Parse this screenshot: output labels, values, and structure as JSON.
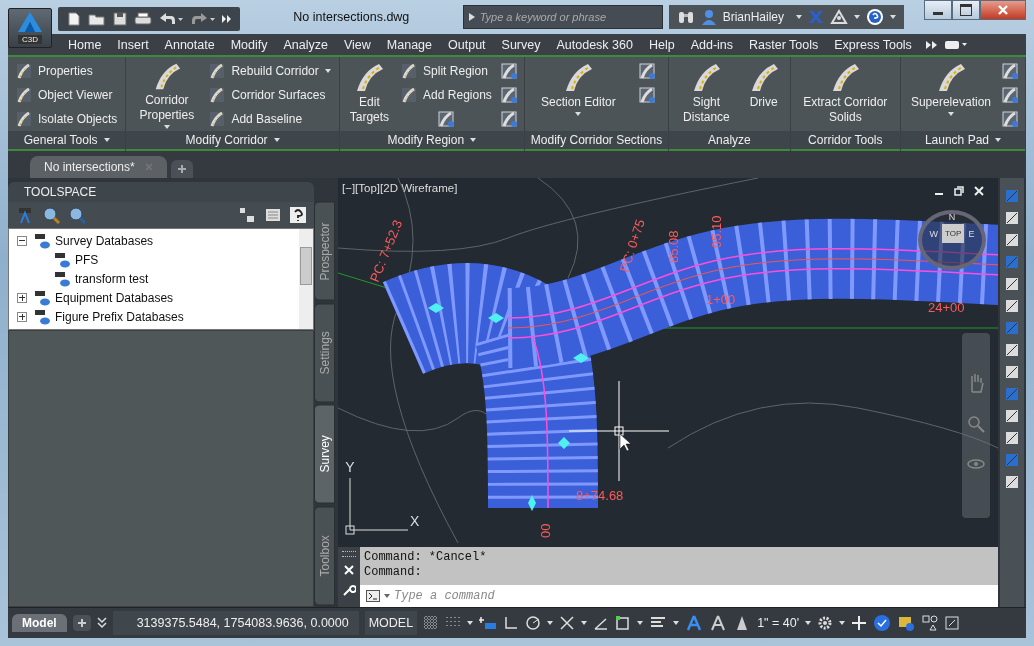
{
  "window": {
    "title": "No intersections.dwg",
    "app_badge": "C3D"
  },
  "search": {
    "placeholder": "Type a keyword or phrase"
  },
  "user": {
    "name": "BrianHailey"
  },
  "ribbon_tabs": [
    "Home",
    "Insert",
    "Annotate",
    "Modify",
    "Analyze",
    "View",
    "Manage",
    "Output",
    "Survey",
    "Autodesk 360",
    "Help",
    "Add-ins",
    "Raster Tools",
    "Express Tools"
  ],
  "ribbon_panels": [
    {
      "title": "General Tools",
      "has_menu": true,
      "tools": [
        {
          "kind": "small",
          "label": "Properties",
          "menu": false
        },
        {
          "kind": "small",
          "label": "Object Viewer",
          "menu": false
        },
        {
          "kind": "small",
          "label": "Isolate Objects",
          "menu": false
        }
      ]
    },
    {
      "title": "Modify Corridor",
      "has_menu": true,
      "tools": [
        {
          "kind": "large",
          "label": "Corridor Properties",
          "menu": true
        },
        {
          "kind": "small",
          "label": "Rebuild Corridor",
          "menu": true
        },
        {
          "kind": "small",
          "label": "Corridor Surfaces",
          "menu": false
        },
        {
          "kind": "small",
          "label": "Add Baseline",
          "menu": false
        }
      ]
    },
    {
      "title": "Modify Region",
      "has_menu": true,
      "tools": [
        {
          "kind": "large",
          "label": "Edit Targets",
          "menu": false
        },
        {
          "kind": "small",
          "label": "Split Region",
          "menu": false
        },
        {
          "kind": "small",
          "label": "Add Regions",
          "menu": false
        },
        {
          "kind": "icon"
        },
        {
          "kind": "icon"
        },
        {
          "kind": "icon"
        },
        {
          "kind": "icon"
        }
      ]
    },
    {
      "title": "Modify Corridor Sections",
      "has_menu": false,
      "tools": [
        {
          "kind": "large",
          "label": "Section Editor",
          "menu": true
        },
        {
          "kind": "icon"
        },
        {
          "kind": "icon"
        }
      ]
    },
    {
      "title": "Analyze",
      "has_menu": false,
      "tools": [
        {
          "kind": "large",
          "label": "Sight Distance",
          "menu": false
        },
        {
          "kind": "large",
          "label": "Drive",
          "menu": false
        }
      ]
    },
    {
      "title": "Corridor Tools",
      "has_menu": false,
      "tools": [
        {
          "kind": "large",
          "label": "Extract Corridor Solids",
          "menu": false
        }
      ]
    },
    {
      "title": "Launch Pad",
      "has_menu": true,
      "tools": [
        {
          "kind": "large",
          "label": "Superelevation",
          "menu": true
        },
        {
          "kind": "icon"
        },
        {
          "kind": "icon"
        },
        {
          "kind": "icon"
        }
      ]
    }
  ],
  "document_tabs": [
    {
      "label": "No intersections*"
    }
  ],
  "toolspace": {
    "title": "TOOLSPACE",
    "tree": [
      {
        "label": "Survey Databases",
        "expanded": true,
        "children": [
          {
            "label": "PFS"
          },
          {
            "label": "transform test"
          }
        ]
      },
      {
        "label": "Equipment Databases",
        "expanded": false
      },
      {
        "label": "Figure Prefix Databases",
        "expanded": false
      }
    ],
    "side_tabs": [
      {
        "label": "Prospector",
        "selected": false
      },
      {
        "label": "Settings",
        "selected": false
      },
      {
        "label": "Survey",
        "selected": true
      },
      {
        "label": "Toolbox",
        "selected": false
      }
    ]
  },
  "viewport": {
    "controls": "[−][Top][2D Wireframe]",
    "viewcube": {
      "face": "TOP",
      "north": "N",
      "west": "W",
      "east": "E"
    },
    "labels": [
      "PC: 7+52.3",
      "PC: 0+75",
      "85.08",
      "95.10",
      "1+00",
      "24+00",
      "8+74.68",
      "00"
    ],
    "ucs": {
      "x_label": "X",
      "y_label": "Y"
    }
  },
  "command_line": {
    "history": [
      "Command: *Cancel*",
      "Command:"
    ],
    "placeholder": "Type a command"
  },
  "status_bar": {
    "layout_tabs": [
      {
        "label": "Model",
        "selected": true
      }
    ],
    "coordinates": "3139375.5484, 1754083.9636, 0.0000",
    "space": "MODEL",
    "scale": "1\" = 40'"
  }
}
